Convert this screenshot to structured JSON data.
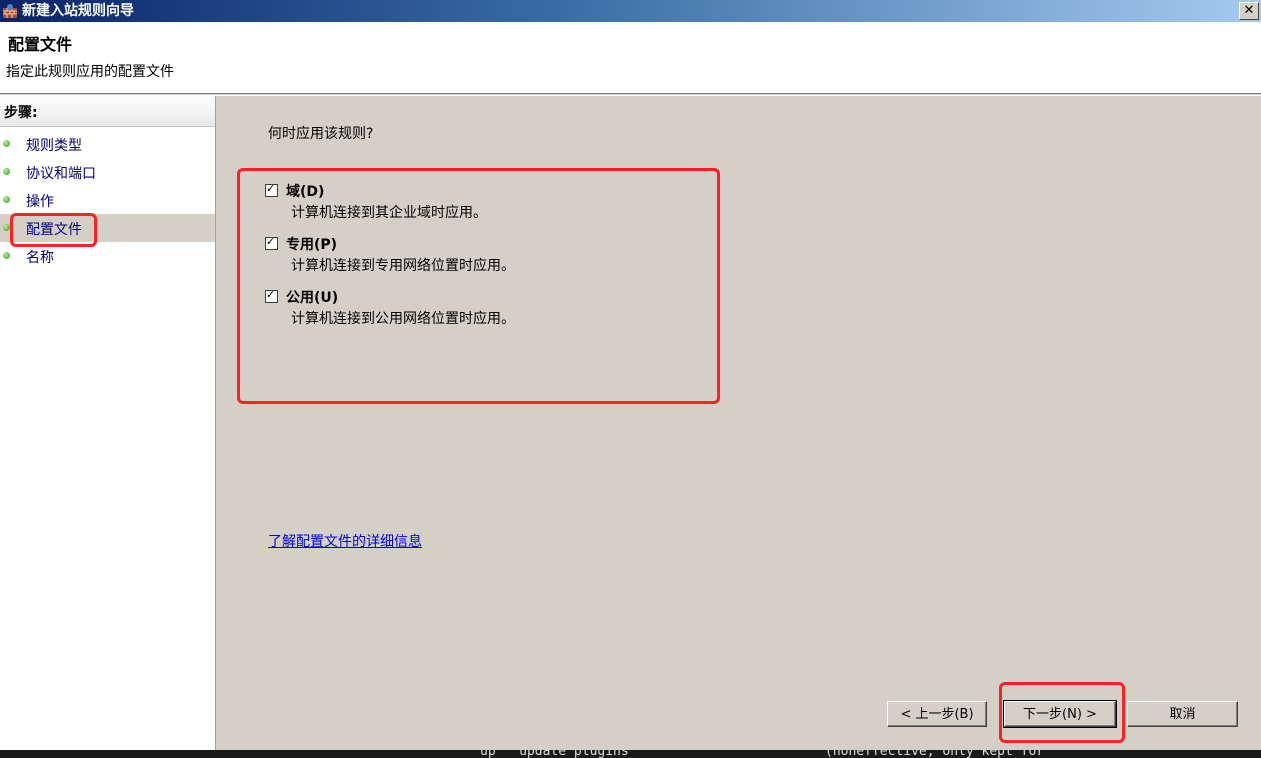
{
  "window": {
    "title": "新建入站规则向导",
    "close_label": "✕"
  },
  "header": {
    "title": "配置文件",
    "description": "指定此规则应用的配置文件"
  },
  "steps": {
    "label": "步骤:",
    "items": [
      {
        "label": "规则类型"
      },
      {
        "label": "协议和端口"
      },
      {
        "label": "操作"
      },
      {
        "label": "配置文件",
        "active": true
      },
      {
        "label": "名称"
      }
    ]
  },
  "main": {
    "question": "何时应用该规则?",
    "options": [
      {
        "title": "域(D)",
        "description": "计算机连接到其企业域时应用。",
        "checked": true
      },
      {
        "title": "专用(P)",
        "description": "计算机连接到专用网络位置时应用。",
        "checked": true
      },
      {
        "title": "公用(U)",
        "description": "计算机连接到公用网络位置时应用。",
        "checked": true
      }
    ],
    "learn_more_link": "了解配置文件的详细信息"
  },
  "buttons": {
    "back": "< 上一步(B)",
    "next": "下一步(N) >",
    "cancel": "取消"
  },
  "background_terminal": {
    "text_left": "up   update plugins",
    "text_right": "(noneffective, only kept for"
  },
  "colors": {
    "annotation": "#ff2020",
    "link": "#0000ee",
    "step_label": "#000080"
  }
}
